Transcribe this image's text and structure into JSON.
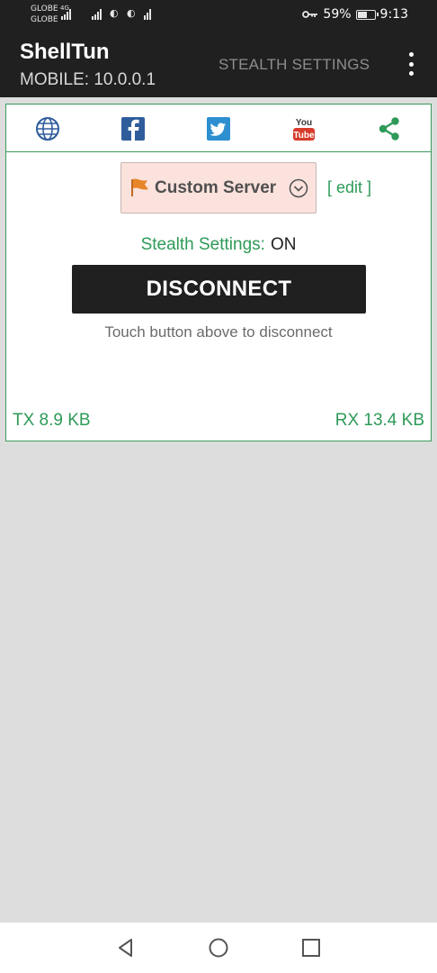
{
  "status_bar": {
    "carrier_1": "GLOBE",
    "carrier_2": "GLOBE",
    "network_1": "4G",
    "battery_percent": "59%",
    "battery_level": 0.59,
    "time": "9:13"
  },
  "app_bar": {
    "title": "ShellTun",
    "subtitle": "MOBILE: 10.0.0.1",
    "stealth_settings_label": "STEALTH SETTINGS"
  },
  "social": {
    "icons": [
      "globe-icon",
      "facebook-icon",
      "twitter-icon",
      "youtube-icon",
      "share-icon"
    ],
    "youtube_top": "You",
    "youtube_bottom": "Tube"
  },
  "server": {
    "label": "Custom Server",
    "edit_label": "[ edit ]"
  },
  "stealth": {
    "label": "Stealth Settings:",
    "value": "ON"
  },
  "connection": {
    "button_label": "DISCONNECT",
    "hint": "Touch button above to disconnect",
    "tx": "TX 8.9 KB",
    "rx": "RX 13.4 KB"
  },
  "colors": {
    "accent_green": "#2e9a58",
    "bar_dark": "#202020",
    "server_bg": "#fbe2dd",
    "flag_orange": "#e8862a",
    "facebook_blue": "#2f5d9c",
    "twitter_blue": "#2d8fd0",
    "youtube_red": "#d63b2b"
  }
}
